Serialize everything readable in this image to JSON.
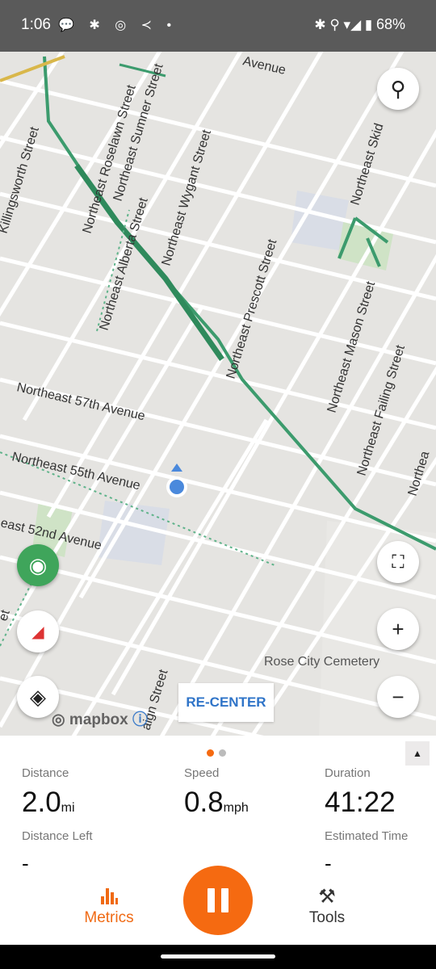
{
  "status_bar": {
    "time": "1:06",
    "left_icons": [
      "chat-bubble-icon",
      "slack-icon",
      "instagram-icon",
      "send-icon",
      "dot-icon"
    ],
    "left_glyphs": "💬 ✱ ◎ ≺ •",
    "right_glyphs": "✱ ⚲ ▾◢ ▮",
    "battery": "68%"
  },
  "map": {
    "street_labels": [
      "Avenue",
      "Northeast Roselawn Street",
      "Northeast Sumner Street",
      "Killingsworth Street",
      "Northeast Wygant Street",
      "Northeast Alberta Street",
      "Northeast Prescott Street",
      "Northeast Skid",
      "Northeast Mason Street",
      "Northeast Failing Street",
      "Northea",
      "Northeast 57th Avenue",
      "Northeast 55th Avenue",
      "east 52nd Avenue",
      "aign Street",
      "et"
    ],
    "poi_label": "Rose City Cemetery",
    "recenter_label": "RE-CENTER",
    "attribution": "mapbox",
    "colors": {
      "road": "#ffffff",
      "trail": "#3c9b6d",
      "park": "#d2e6c9",
      "land": "#e5e4e1",
      "location": "#4a89dc"
    }
  },
  "panel": {
    "page_dots": 2,
    "active_dot": 1,
    "metrics": [
      {
        "label": "Distance",
        "value": "2.0",
        "unit": "mi"
      },
      {
        "label": "Speed",
        "value": "0.8",
        "unit": "mph"
      },
      {
        "label": "Duration",
        "value": "41:22",
        "unit": ""
      },
      {
        "label": "Distance Left",
        "value": "-",
        "unit": ""
      },
      {
        "label": "Estimated Time",
        "value": "-",
        "unit": ""
      }
    ],
    "tabs": [
      {
        "label": "Metrics",
        "icon": "bar-chart-icon"
      },
      {
        "label": "Tools",
        "icon": "tools-icon"
      }
    ],
    "accent_color": "#f56a11"
  }
}
